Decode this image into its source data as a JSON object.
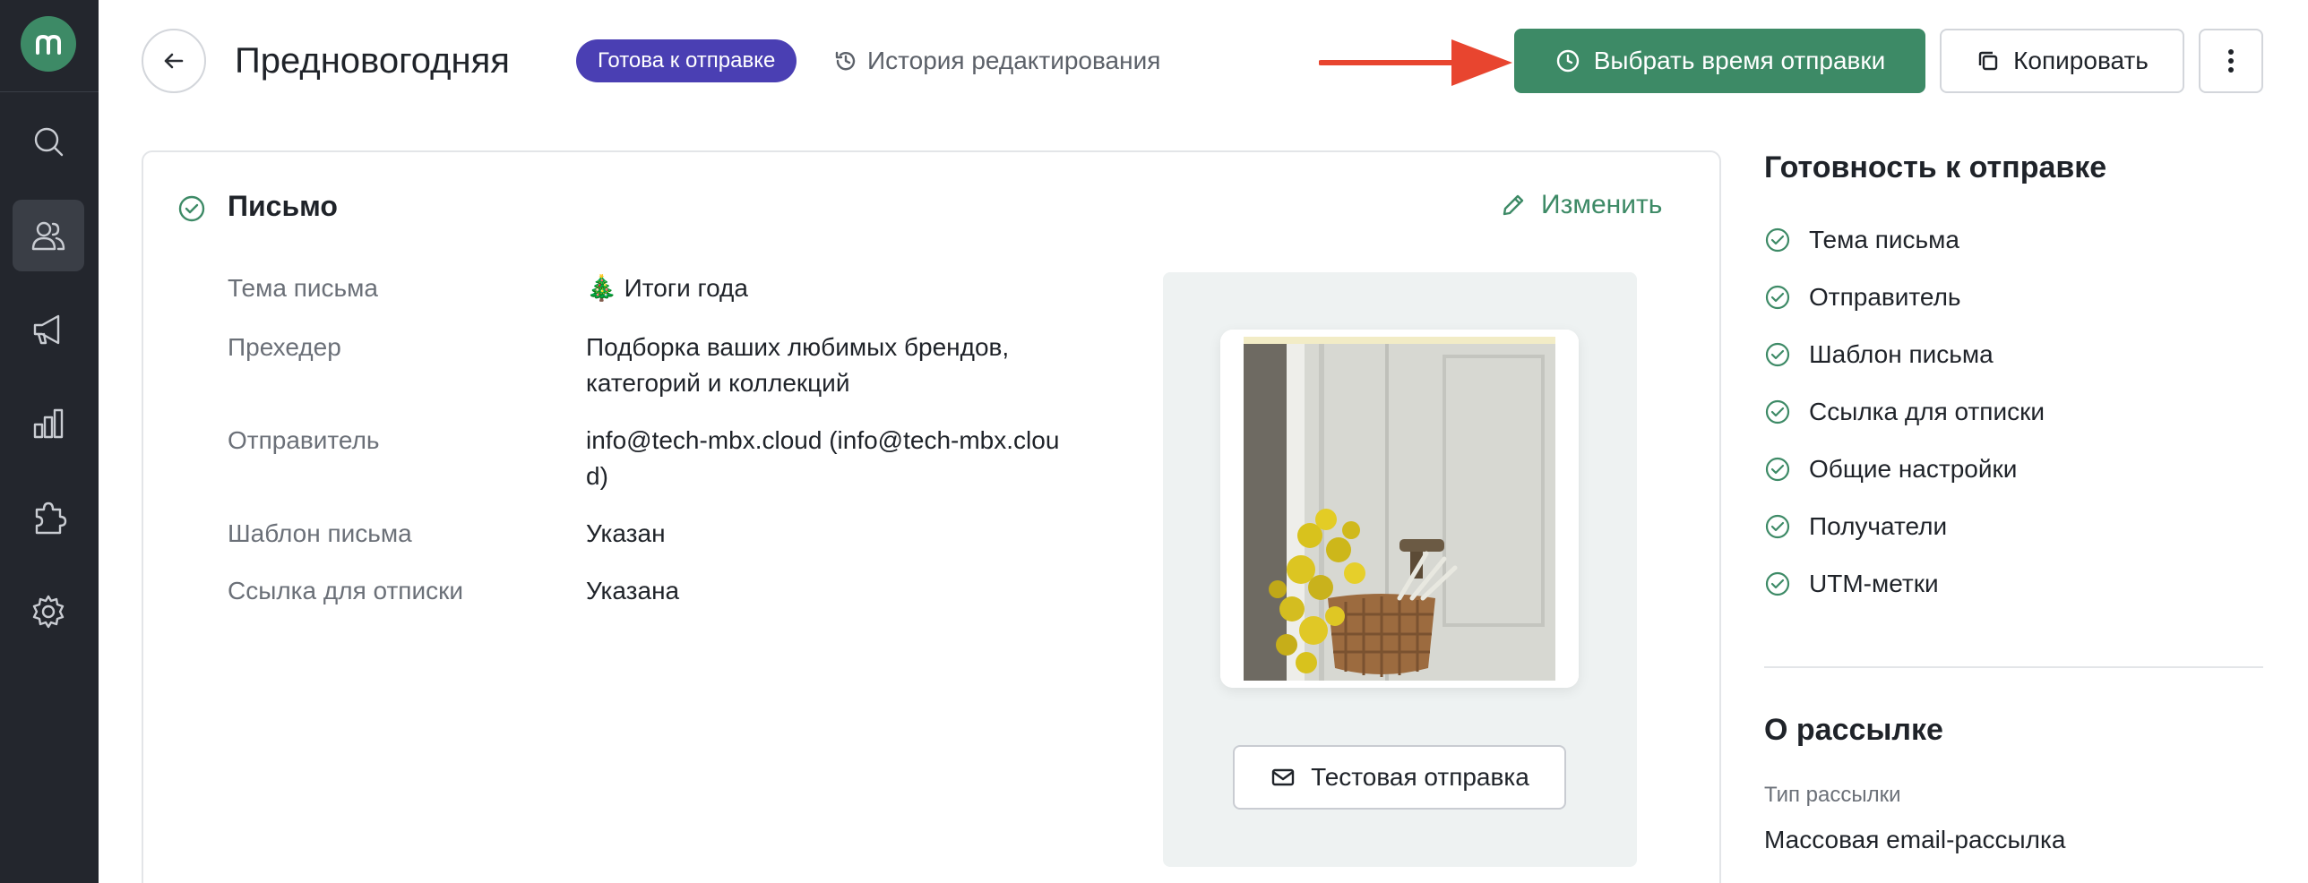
{
  "sidebar": {
    "logo_letter": "m",
    "items": [
      {
        "icon": "search-icon"
      },
      {
        "icon": "users-icon",
        "active": true
      },
      {
        "icon": "megaphone-icon"
      },
      {
        "icon": "chart-icon"
      },
      {
        "icon": "puzzle-icon"
      },
      {
        "icon": "gear-icon"
      }
    ]
  },
  "header": {
    "title": "Предновогодняя",
    "status": "Готова к отправке",
    "history_label": "История редактирования",
    "schedule_button": "Выбрать время отправки",
    "copy_button": "Копировать"
  },
  "letter": {
    "title": "Письмо",
    "edit_label": "Изменить",
    "fields": [
      {
        "label": "Тема письма",
        "value": "🎄 Итоги года"
      },
      {
        "label": "Прехедер",
        "value": "Подборка ваших любимых брендов, категорий и коллекций"
      },
      {
        "label": "Отправитель",
        "value": "info@tech-mbx.cloud (info@tech-mbx.cloud)"
      },
      {
        "label": "Шаблон письма",
        "value": "Указан"
      },
      {
        "label": "Ссылка для отписки",
        "value": "Указана"
      }
    ],
    "test_send_label": "Тестовая отправка"
  },
  "readiness": {
    "title": "Готовность к отправке",
    "items": [
      "Тема письма",
      "Отправитель",
      "Шаблон письма",
      "Ссылка для отписки",
      "Общие настройки",
      "Получатели",
      "UTM-метки"
    ]
  },
  "about": {
    "title": "О рассылке",
    "type_label": "Тип рассылки",
    "type_value": "Массовая email-рассылка"
  },
  "colors": {
    "accent_green": "#3d8a66",
    "badge_purple": "#4a3fb3",
    "sidebar_bg": "#23262d",
    "arrow_red": "#e8452f"
  }
}
